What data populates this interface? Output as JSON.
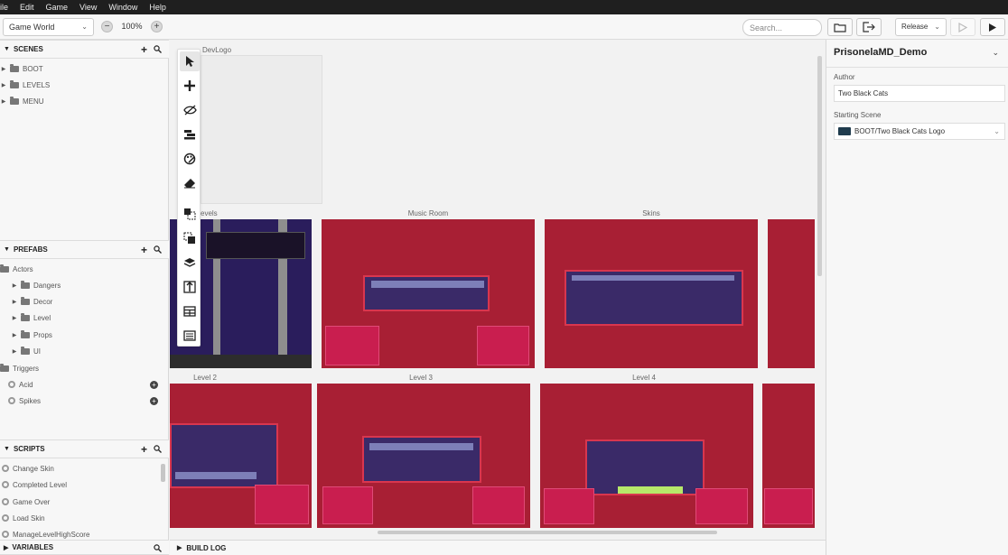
{
  "menu": [
    "ile",
    "Edit",
    "Game",
    "View",
    "Window",
    "Help"
  ],
  "toolbar": {
    "world_select": "Game World",
    "zoom_out": "−",
    "zoom": "100%",
    "zoom_in": "+",
    "search_placeholder": "Search...",
    "build_select": "Release"
  },
  "scenes_section": {
    "title": "SCENES",
    "items": [
      "BOOT",
      "LEVELS",
      "MENU"
    ]
  },
  "prefabs_section": {
    "title": "PREFABS",
    "actors": "Actors",
    "actor_items": [
      "Dangers",
      "Decor",
      "Level",
      "Props",
      "UI"
    ],
    "triggers": "Triggers",
    "trigger_items": [
      "Acid",
      "Spikes"
    ]
  },
  "scripts_section": {
    "title": "SCRIPTS",
    "items": [
      "Change Skin",
      "Completed Level",
      "Game Over",
      "Load Skin",
      "ManageLevelHighScore"
    ]
  },
  "variables_section": {
    "title": "VARIABLES"
  },
  "canvas": {
    "scene_labels": [
      "DevLogo",
      "evels",
      "Music Room",
      "Skins",
      "Level 2",
      "Level 3",
      "Level 4"
    ]
  },
  "build_log": "BUILD LOG",
  "properties": {
    "project_name": "PrisonelaMD_Demo",
    "author_label": "Author",
    "author_value": "Two Black Cats",
    "starting_scene_label": "Starting Scene",
    "starting_scene_value": "BOOT/Two Black Cats Logo"
  },
  "colors": {
    "scene_bg": "#a81f34",
    "scene_inner": "#3a2a68",
    "menubar": "#1f1f1f"
  }
}
